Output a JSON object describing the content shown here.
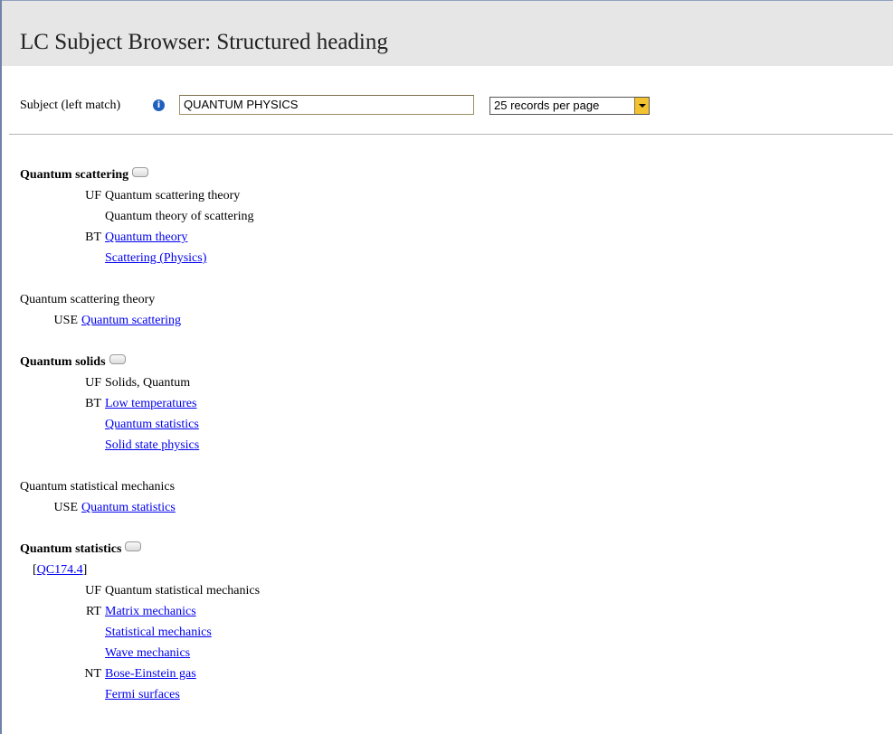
{
  "page": {
    "title": "LC Subject Browser: Structured heading"
  },
  "search": {
    "label": "Subject (left match)",
    "info_icon": "info-icon",
    "value": "QUANTUM PHYSICS",
    "per_page": "25 records per page"
  },
  "entries": [
    {
      "heading": "Quantum scattering",
      "uf": [
        "Quantum scattering theory",
        "Quantum theory of scattering"
      ],
      "bt": [
        "Quantum theory",
        "Scattering (Physics)"
      ]
    },
    {
      "heading": "Quantum scattering theory",
      "use": "Quantum scattering"
    },
    {
      "heading": "Quantum solids",
      "uf": [
        "Solids, Quantum"
      ],
      "bt": [
        "Low temperatures",
        "Quantum statistics",
        "Solid state physics"
      ]
    },
    {
      "heading": "Quantum statistical mechanics",
      "use": "Quantum statistics"
    },
    {
      "heading": "Quantum statistics",
      "class_no": "QC174.4",
      "uf": [
        "Quantum statistical mechanics"
      ],
      "rt": [
        "Matrix mechanics",
        "Statistical mechanics",
        "Wave mechanics"
      ],
      "nt": [
        "Bose-Einstein gas",
        "Fermi surfaces"
      ]
    }
  ],
  "labels": {
    "uf": "UF",
    "bt": "BT",
    "rt": "RT",
    "nt": "NT",
    "use": "USE"
  }
}
